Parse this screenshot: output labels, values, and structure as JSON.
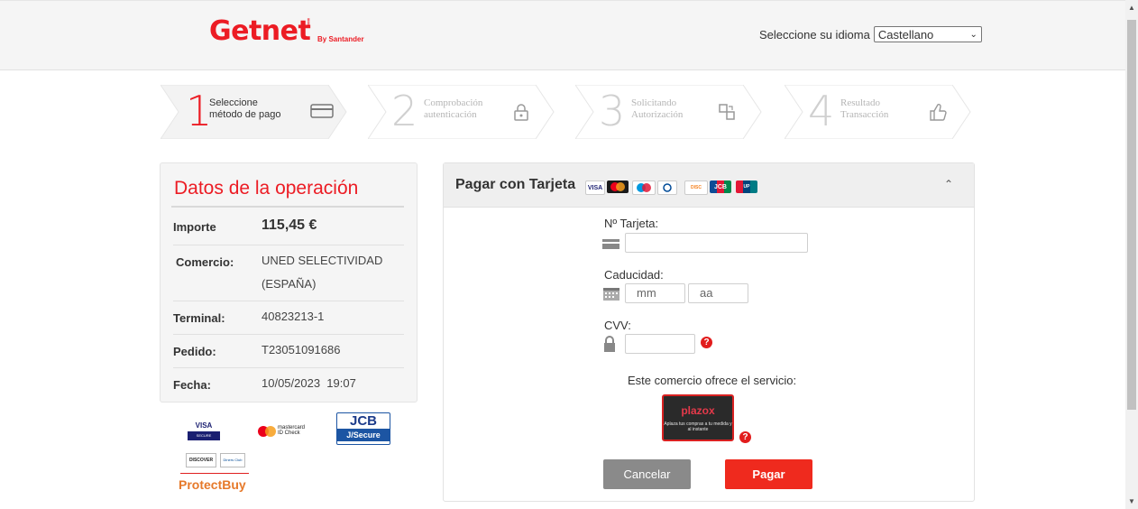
{
  "header": {
    "brand": "Getnet",
    "brand_sub": "By Santander",
    "language_label": "Seleccione su idioma",
    "language_value": "Castellano"
  },
  "steps": [
    {
      "number": "1",
      "line1": "Seleccione",
      "line2": "método de pago",
      "icon": "card-icon",
      "active": true
    },
    {
      "number": "2",
      "line1": "Comprobación",
      "line2": "autenticación",
      "icon": "lock-icon",
      "active": false
    },
    {
      "number": "3",
      "line1": "Solicitando",
      "line2": "Autorización",
      "icon": "transfer-icon",
      "active": false
    },
    {
      "number": "4",
      "line1": "Resultado",
      "line2": "Transacción",
      "icon": "thumbs-up-icon",
      "active": false
    }
  ],
  "operation": {
    "title": "Datos de la operación",
    "amount_label": "Importe",
    "amount_value": "115,45 €",
    "merchant_label": "Comercio:",
    "merchant_value_line1": "UNED SELECTIVIDAD",
    "merchant_value_line2": "(ESPAÑA)",
    "terminal_label": "Terminal:",
    "terminal_value": "40823213-1",
    "order_label": "Pedido:",
    "order_value": "T23051091686",
    "date_label": "Fecha:",
    "date_value": "10/05/2023  19:07"
  },
  "security_logos": {
    "visa_secure_line1": "VISA",
    "visa_secure_line2": "SECURE",
    "mastercard_line1": "mastercard",
    "mastercard_line2": "ID Check",
    "jcb_line1": "JCB",
    "jcb_line2": "J/Secure",
    "discover": "DISCOVER",
    "diners": "Diners Club",
    "protectbuy": "ProtectBuy"
  },
  "payment": {
    "title": "Pagar con Tarjeta",
    "card_brands": [
      "VISA",
      "Mastercard",
      "Maestro",
      "Diners",
      "Discover",
      "JCB",
      "UnionPay"
    ],
    "card_number_label": "Nº Tarjeta:",
    "card_number_value": "",
    "expiry_label": "Caducidad:",
    "month_placeholder": "mm",
    "year_placeholder": "aa",
    "cvv_label": "CVV:",
    "cvv_value": "",
    "service_label": "Este comercio ofrece el servicio:",
    "plazox_name": "plazox",
    "plazox_tagline": "Aplaza tus compras a tu medida y al instante",
    "cancel_label": "Cancelar",
    "pay_label": "Pagar"
  },
  "colors": {
    "brand_red": "#ec1c24",
    "pay_button": "#ef2a1e",
    "cancel_button": "#8a8a8a"
  }
}
